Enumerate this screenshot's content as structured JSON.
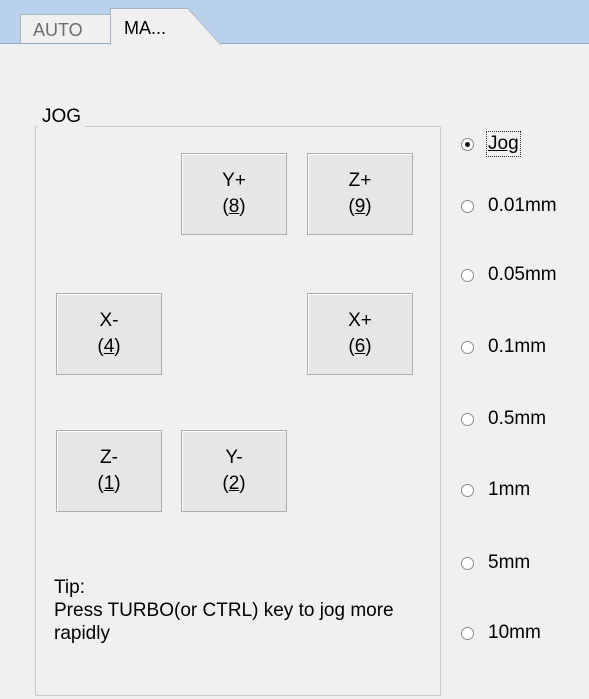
{
  "tabs": [
    {
      "label": "AUTO",
      "active": false
    },
    {
      "label": "MA...",
      "active": true
    }
  ],
  "jog_group": {
    "title": "JOG",
    "buttons": {
      "y_plus": {
        "axis": "Y+",
        "key_open": "(",
        "key": "8",
        "key_close": ")"
      },
      "z_plus": {
        "axis": "Z+",
        "key_open": "(",
        "key": "9",
        "key_close": ")"
      },
      "x_minus": {
        "axis": "X-",
        "key_open": "(",
        "key": "4",
        "key_close": ")"
      },
      "x_plus": {
        "axis": "X+",
        "key_open": "(",
        "key": "6",
        "key_close": ")"
      },
      "z_minus": {
        "axis": "Z-",
        "key_open": "(",
        "key": "1",
        "key_close": ")"
      },
      "y_minus": {
        "axis": "Y-",
        "key_open": "(",
        "key": "2",
        "key_close": ")"
      }
    },
    "tip_title": "Tip:",
    "tip_text": "Press TURBO(or CTRL) key to jog more rapidly"
  },
  "step_options": [
    {
      "label": "Jog",
      "checked": true
    },
    {
      "label": "0.01mm",
      "checked": false
    },
    {
      "label": "0.05mm",
      "checked": false
    },
    {
      "label": "0.1mm",
      "checked": false
    },
    {
      "label": "0.5mm",
      "checked": false
    },
    {
      "label": "1mm",
      "checked": false
    },
    {
      "label": "5mm",
      "checked": false
    },
    {
      "label": "10mm",
      "checked": false
    }
  ],
  "colors": {
    "tab_strip": "#b9d1ea",
    "window_bg": "#f0f0f0",
    "button_bg": "#e6e6e6"
  }
}
